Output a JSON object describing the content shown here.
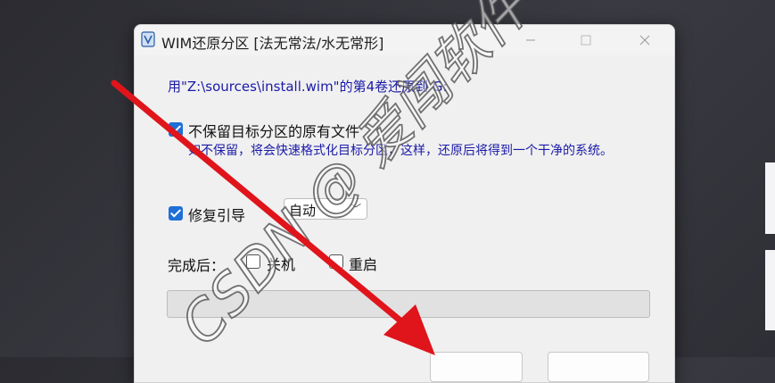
{
  "window": {
    "title": "WIM还原分区 [法无常法/水无常形]"
  },
  "prompt_text": "用\"Z:\\sources\\install.wim\"的第4卷还原到 G:",
  "options": {
    "no_keep": {
      "label": "不保留目标分区的原有文件",
      "checked": true,
      "hint": "如不保留，将会快速格式化目标分区，这样，还原后将得到一个干净的系统。"
    },
    "repair_boot": {
      "label": "修复引导",
      "checked": true,
      "mode_value": "自动"
    }
  },
  "after_done": {
    "label": "完成后：",
    "shutdown_label": "关机",
    "restart_label": "重启"
  },
  "watermark": {
    "text": "CSDN @ 爱闯软件"
  },
  "colors": {
    "accent": "#1f6fd6",
    "prompt_text": "#1a1aa8",
    "arrow": "#e0141b"
  }
}
